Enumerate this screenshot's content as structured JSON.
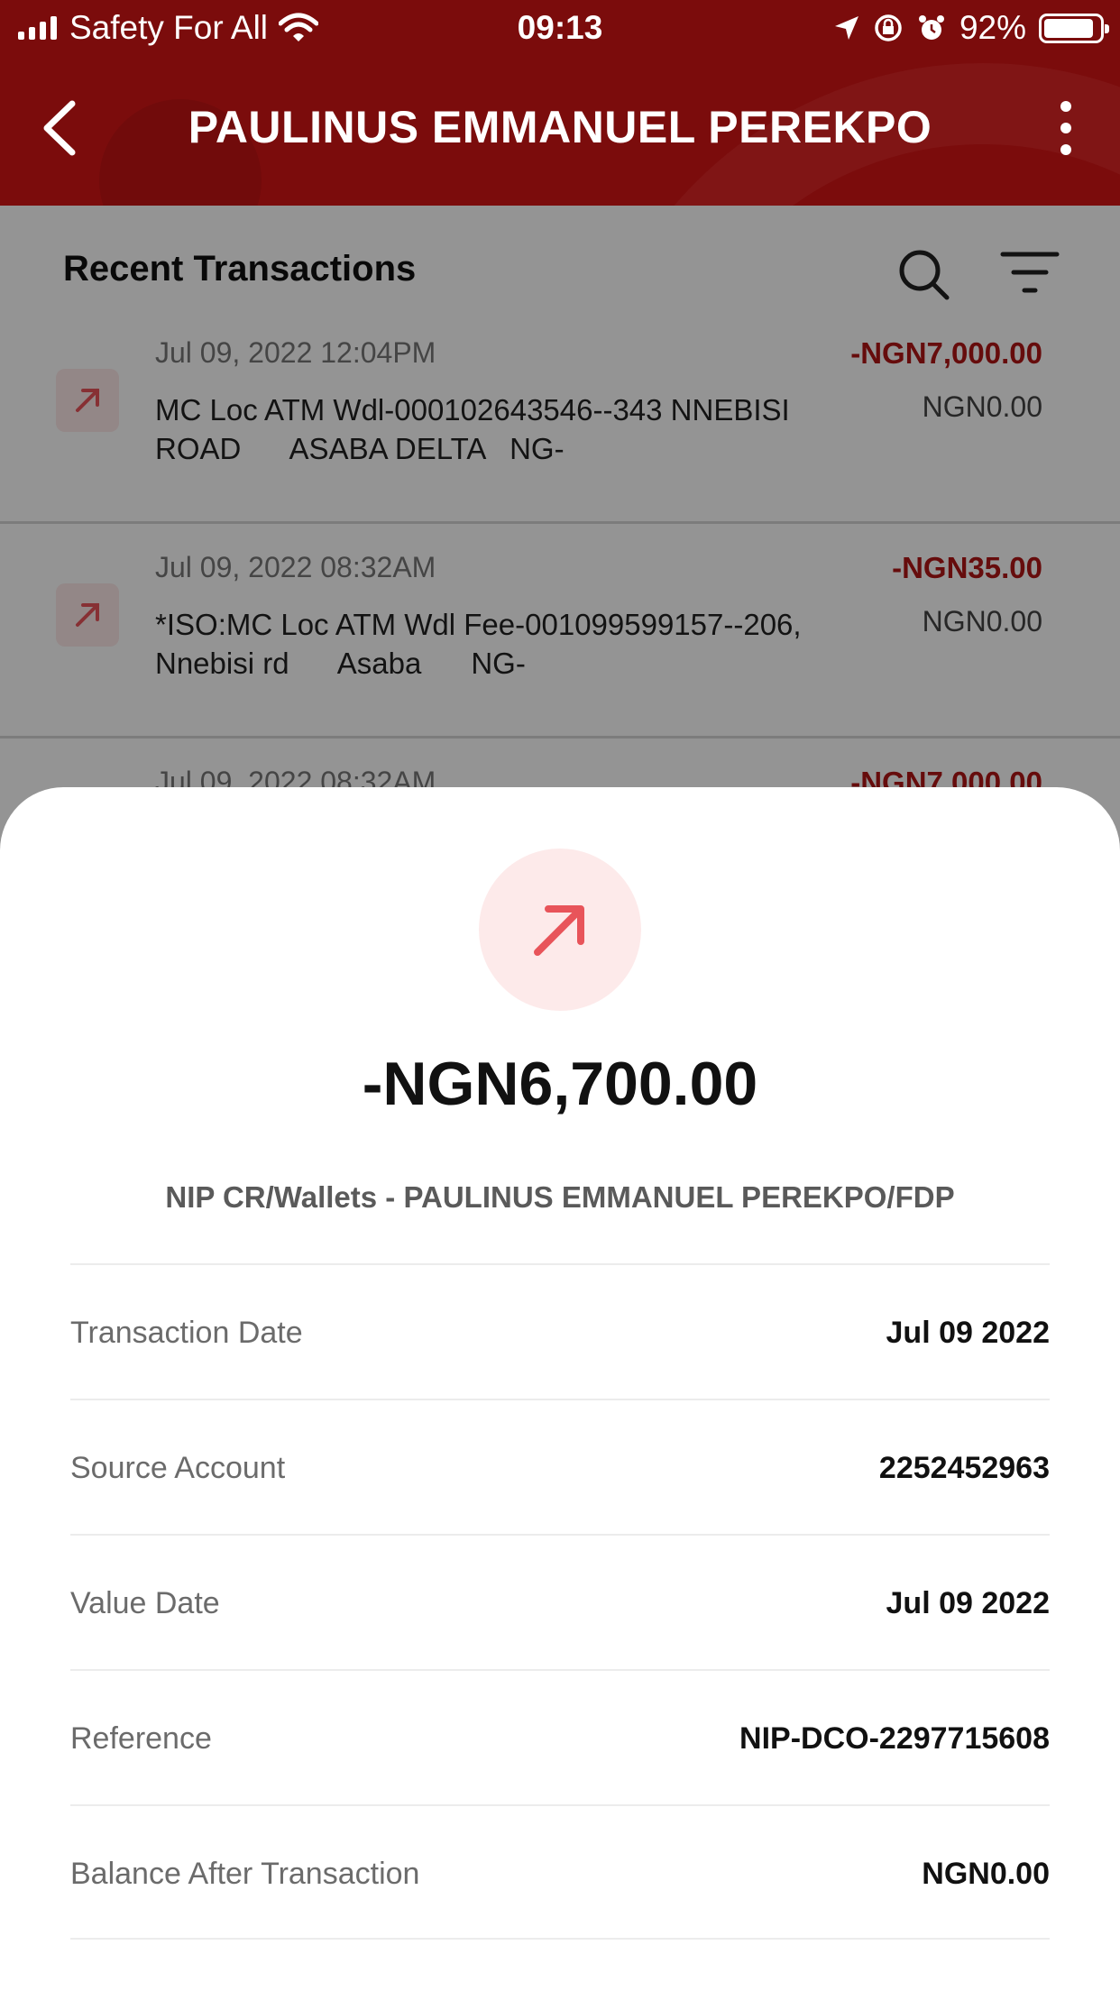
{
  "status_bar": {
    "carrier": "Safety For All",
    "time": "09:13",
    "battery": "92%"
  },
  "header": {
    "title": "PAULINUS EMMANUEL PEREKPO"
  },
  "section": {
    "title": "Recent Transactions"
  },
  "transactions": [
    {
      "date": "Jul 09, 2022 12:04PM",
      "description": "MC Loc ATM Wdl-000102643546--343 NNEBISI ROAD      ASABA DELTA   NG-",
      "amount": "-NGN7,000.00",
      "balance": "NGN0.00"
    },
    {
      "date": "Jul 09, 2022 08:32AM",
      "description": "*ISO:MC Loc ATM Wdl Fee-001099599157--206, Nnebisi rd      Asaba      NG-",
      "amount": "-NGN35.00",
      "balance": "NGN0.00"
    },
    {
      "date": "Jul 09, 2022 08:32AM",
      "description": "",
      "amount": "-NGN7,000.00",
      "balance": ""
    }
  ],
  "details_sheet": {
    "amount": "-NGN6,700.00",
    "description": "NIP CR/Wallets - PAULINUS EMMANUEL PEREKPO/FDP",
    "rows": [
      {
        "label": "Transaction Date",
        "value": "Jul 09 2022"
      },
      {
        "label": "Source Account",
        "value": "2252452963"
      },
      {
        "label": "Value Date",
        "value": "Jul 09 2022"
      },
      {
        "label": "Reference",
        "value": "NIP-DCO-2297715608"
      },
      {
        "label": "Balance After Transaction",
        "value": "NGN0.00"
      }
    ]
  },
  "colors": {
    "header_bg": "#7b0c0c",
    "debit_red": "#b01515",
    "icon_red": "#e8545a",
    "icon_bg": "#fdeaea"
  },
  "icons": [
    "signal-icon",
    "wifi-icon",
    "location-icon",
    "orientation-lock-icon",
    "alarm-icon",
    "battery-icon",
    "back-arrow-icon",
    "more-vertical-icon",
    "search-icon",
    "filter-icon",
    "outgoing-arrow-icon"
  ]
}
